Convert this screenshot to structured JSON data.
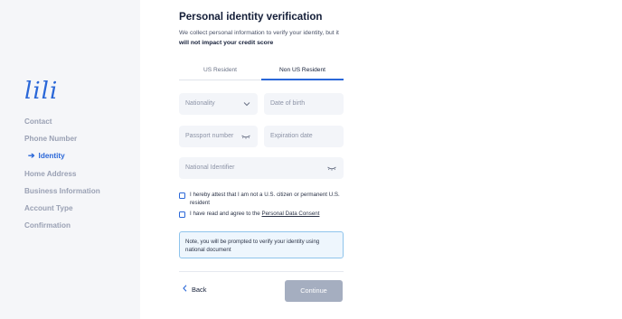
{
  "sidebar": {
    "logo": "lili",
    "steps": [
      {
        "label": "Contact"
      },
      {
        "label": "Phone Number"
      },
      {
        "label": "Identity",
        "arrow": "➔"
      },
      {
        "label": "Home Address"
      },
      {
        "label": "Business Information"
      },
      {
        "label": "Account Type"
      },
      {
        "label": "Confirmation"
      }
    ],
    "active_step": "Identity"
  },
  "main": {
    "title": "Personal identity verification",
    "description_prefix": "We collect personal information to verify your identity, but it ",
    "description_bold": "will not impact your credit score",
    "tabs": [
      {
        "label": "US Resident",
        "active": false
      },
      {
        "label": "Non US Resident",
        "active": true
      }
    ],
    "fields": {
      "nationality": {
        "placeholder": "Nationality",
        "icon": "chevron-down-icon"
      },
      "date_of_birth": {
        "placeholder": "Date of birth"
      },
      "passport_number": {
        "placeholder": "Passport number",
        "icon": "eye-closed-icon"
      },
      "expiration_date": {
        "placeholder": "Expiration date"
      },
      "national_identifier": {
        "placeholder": "National Identifier",
        "icon": "eye-closed-icon"
      }
    },
    "checkboxes": {
      "attest_label": "I hereby attest that I am not a U.S. citizen or permanent U.S. resident",
      "consent_prefix": "I have read and agree to the ",
      "consent_link": "Personal Data Consent"
    },
    "note": "Note, you will be prompted to verify your identity using national document",
    "back_label": "Back",
    "continue_label": "Continue"
  },
  "colors": {
    "accent": "#2a67d8",
    "sidebar_bg": "#f5f6f9",
    "field_bg": "#f3f5f9",
    "note_bg": "#eef6fd",
    "note_border": "#8fc4ec",
    "disabled_button": "#a5aec0"
  }
}
